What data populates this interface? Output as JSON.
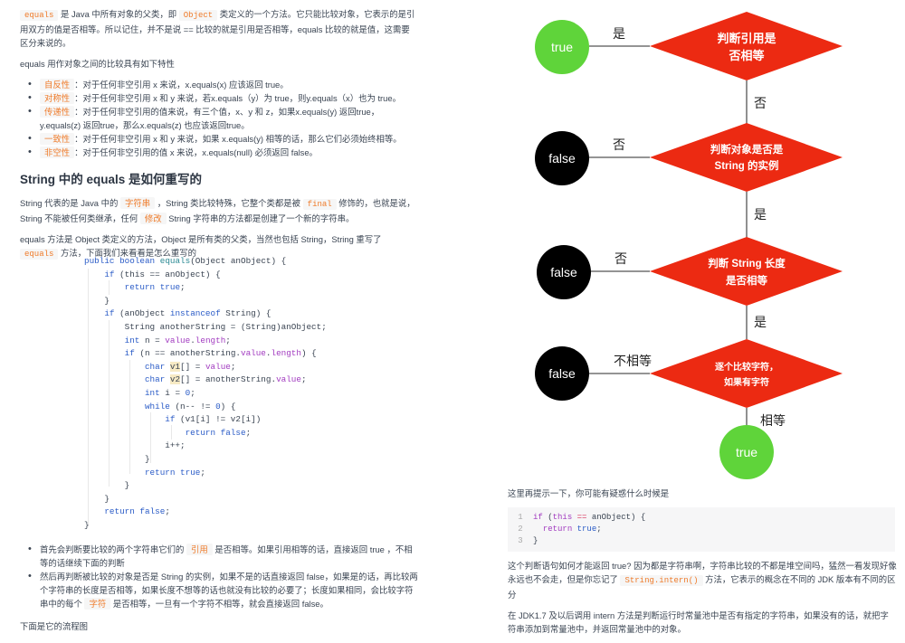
{
  "left": {
    "intro": {
      "code1": "equals",
      "t1": " 是 Java 中所有对象的父类，即 ",
      "code2": "Object",
      "t2": " 类定义的一个方法。它只能比较对象，它表示的是引用双方的值是否相等。所以记住，并不是说 == 比较的就是引用是否相等，equals 比较的就是值，这需要区分来说的。"
    },
    "props_intro": "equals 用作对象之间的比较具有如下特性",
    "properties": [
      {
        "name": "自反性",
        "text": "：对于任何非空引用 x 来说，x.equals(x) 应该返回 true。"
      },
      {
        "name": "对称性",
        "text": "：对于任何非空引用 x 和 y 来说，若x.equals（y）为 true，则y.equals（x）也为 true。"
      },
      {
        "name": "传递性",
        "text": "：对于任何非空引用的值来说，有三个值，x、y 和 z，如果x.equals(y) 返回true，y.equals(z) 返回true，那么x.equals(z) 也应该返回true。"
      },
      {
        "name": "一致性",
        "text": "：对于任何非空引用 x 和 y 来说，如果 x.equals(y) 相等的话，那么它们必须始终相等。"
      },
      {
        "name": "非空性",
        "text": "：对于任何非空引用的值 x 来说，x.equals(null) 必须返回 false。"
      }
    ],
    "heading": "String 中的 equals 是如何重写的",
    "p1": {
      "t1": "String 代表的是 Java 中的 ",
      "h1": "字符串",
      "t2": " ，String 类比较特殊，它整个类都是被 ",
      "c1": "final",
      "t3": " 修饰的，也就是说，String 不能被任何类继承，任何 ",
      "h2": "修改",
      "t4": " String 字符串的方法都是创建了一个新的字符串。"
    },
    "p2": {
      "t1": "equals 方法是 Object 类定义的方法，Object 是所有类的父类，当然也包括 String，String 重写了 ",
      "c1": "equals",
      "t2": " 方法，下面我们来看看是怎么重写的"
    },
    "code_lines": [
      "public boolean equals(Object anObject) {",
      "    if (this == anObject) {",
      "        return true;",
      "    }",
      "    if (anObject instanceof String) {",
      "        String anotherString = (String)anObject;",
      "        int n = value.length;",
      "        if (n == anotherString.value.length) {",
      "            char v1[] = value;",
      "            char v2[] = anotherString.value;",
      "            int i = 0;",
      "            while (n-- != 0) {",
      "                if (v1[i] != v2[i])",
      "                    return false;",
      "                i++;",
      "            }",
      "            return true;",
      "        }",
      "    }",
      "    return false;",
      "}"
    ],
    "bullets": [
      {
        "t1": "首先会判断要比较的两个字符串它们的 ",
        "h": "引用",
        "t2": " 是否相等。如果引用相等的话，直接返回 true ，不相等的话继续下面的判断"
      },
      {
        "t1": "然后再判断被比较的对象是否是 String 的实例，如果不是的话直接返回 false，如果是的话，再比较两个字符串的长度是否相等，如果长度不想等的话也就没有比较的必要了；长度如果相同，会比较字符串中的每个 ",
        "h": "字符",
        "t2": " 是否相等，一旦有一个字符不相等，就会直接返回 false。"
      }
    ],
    "flow_caption": "下面是它的流程图"
  },
  "flowchart": {
    "colors": {
      "decision": "#ec2a12",
      "true_node": "#5fd43a",
      "false_node": "#000000",
      "line": "#555555"
    },
    "decisions": [
      {
        "line1": "判断引用是",
        "line2": "否相等"
      },
      {
        "line1": "判断对象是否是",
        "line2": "String 的实例"
      },
      {
        "line1": "判断 String 长度",
        "line2": "是否相等"
      },
      {
        "line1": "逐个比较字符，",
        "line2": "如果有字符"
      }
    ],
    "terminals": [
      "true",
      "false",
      "false",
      "false",
      "true"
    ],
    "edge_labels": {
      "d1_left": "是",
      "d1_down": "否",
      "d2_left": "否",
      "d2_down": "是",
      "d3_left": "否",
      "d3_down": "是",
      "d4_left": "不相等",
      "d4_down": "相等"
    }
  },
  "right": {
    "hint": "这里再提示一下，你可能有疑惑什么时候是",
    "snippet": {
      "line_numbers": [
        "1",
        "2",
        "3"
      ],
      "lines": [
        "if (this == anObject) {",
        "  return true;",
        "}"
      ]
    },
    "p1": {
      "t1": "这个判断语句如何才能返回 true? 因为都是字符串啊，字符串比较的不都是堆空间吗，猛然一看发现好像永远也不会走，但是你忘记了 ",
      "c1": "String.intern()",
      "t2": " 方法，它表示的概念在不同的 JDK 版本有不同的区分"
    },
    "p2": "在 JDK1.7 及以后调用 intern 方法是判断运行时常量池中是否有指定的字符串，如果没有的话，就把字符串添加到常量池中，并返回常量池中的对象。"
  }
}
